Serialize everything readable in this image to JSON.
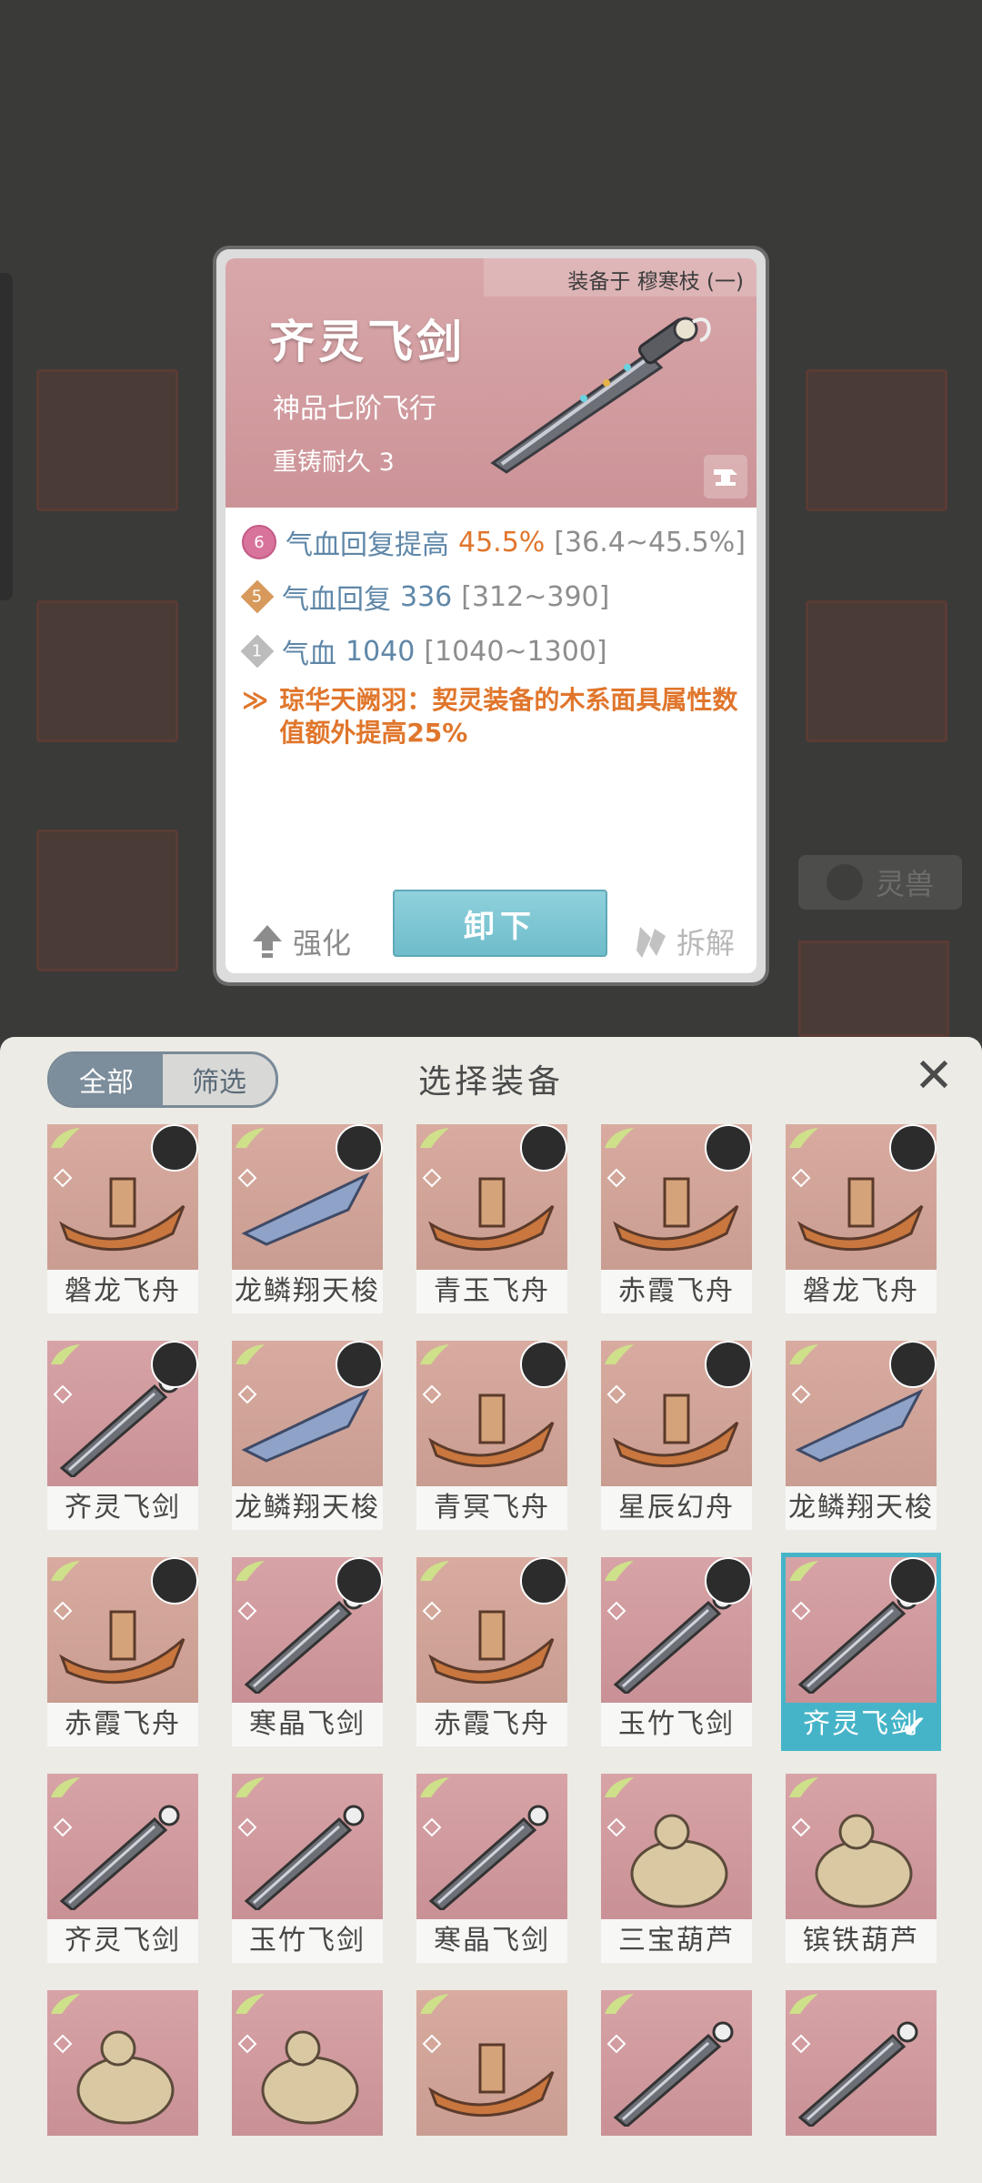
{
  "detail": {
    "equipped_on": "装备于 穆寒枝 (一)",
    "name": "齐灵飞剑",
    "grade": "神品七阶飞行",
    "durability": "重铸耐久 3",
    "stats": [
      {
        "badge": "6",
        "label": "气血回复提高",
        "value": "45.5%",
        "range": "[36.4~45.5%]"
      },
      {
        "badge": "5",
        "label": "气血回复",
        "value": "336",
        "range": "[312~390]"
      },
      {
        "badge": "1",
        "label": "气血",
        "value": "1040",
        "range": "[1040~1300]"
      }
    ],
    "special": "琼华天阙羽：契灵装备的木系面具属性数值额外提高25%",
    "actions": {
      "strengthen": "强化",
      "unequip": "卸下",
      "dismantle": "拆解"
    }
  },
  "background": {
    "spirit_beast": "灵兽"
  },
  "panel": {
    "title": "选择装备",
    "filters": {
      "all": "全部",
      "filter": "筛选"
    },
    "items": [
      {
        "name": "磐龙飞舟",
        "type": "boat",
        "avatar": true
      },
      {
        "name": "龙鳞翔天梭",
        "type": "shuttle",
        "avatar": true
      },
      {
        "name": "青玉飞舟",
        "type": "boat",
        "avatar": true
      },
      {
        "name": "赤霞飞舟",
        "type": "boat",
        "avatar": true
      },
      {
        "name": "磐龙飞舟",
        "type": "boat",
        "avatar": true
      },
      {
        "name": "齐灵飞剑",
        "type": "sword",
        "avatar": true
      },
      {
        "name": "龙鳞翔天梭",
        "type": "shuttle",
        "avatar": true
      },
      {
        "name": "青冥飞舟",
        "type": "boat",
        "avatar": true
      },
      {
        "name": "星辰幻舟",
        "type": "boat",
        "avatar": true
      },
      {
        "name": "龙鳞翔天梭",
        "type": "shuttle",
        "avatar": true
      },
      {
        "name": "赤霞飞舟",
        "type": "boat",
        "avatar": true
      },
      {
        "name": "寒晶飞剑",
        "type": "sword",
        "avatar": true
      },
      {
        "name": "赤霞飞舟",
        "type": "boat",
        "avatar": true
      },
      {
        "name": "玉竹飞剑",
        "type": "sword",
        "avatar": true
      },
      {
        "name": "齐灵飞剑",
        "type": "sword",
        "avatar": true,
        "selected": true
      },
      {
        "name": "齐灵飞剑",
        "type": "sword",
        "avatar": false
      },
      {
        "name": "玉竹飞剑",
        "type": "sword",
        "avatar": false
      },
      {
        "name": "寒晶飞剑",
        "type": "sword",
        "avatar": false
      },
      {
        "name": "三宝葫芦",
        "type": "gourd",
        "avatar": false
      },
      {
        "name": "镔铁葫芦",
        "type": "gourd",
        "avatar": false
      },
      {
        "name": "",
        "type": "gourd",
        "avatar": false
      },
      {
        "name": "",
        "type": "gourd",
        "avatar": false
      },
      {
        "name": "",
        "type": "boat",
        "avatar": false
      },
      {
        "name": "",
        "type": "sword",
        "avatar": false
      },
      {
        "name": "",
        "type": "sword",
        "avatar": false
      }
    ]
  }
}
